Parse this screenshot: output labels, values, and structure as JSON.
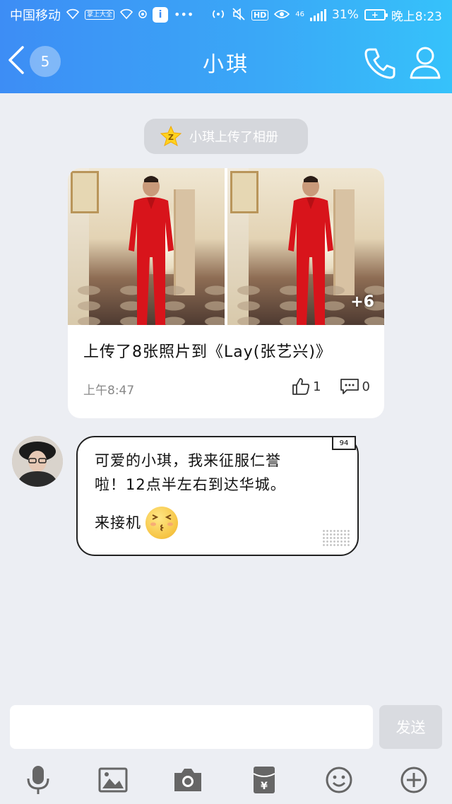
{
  "status_bar": {
    "carrier": "中国移动",
    "badge_text": "掌上大全",
    "network": "46",
    "battery_percent": "31%",
    "battery_symbol": "+",
    "time": "晚上8:23"
  },
  "nav": {
    "unread_count": "5",
    "title": "小琪"
  },
  "notice": {
    "text": "小琪上传了相册"
  },
  "album": {
    "more_photos": "+6",
    "caption": "上传了8张照片到《Lay(张艺兴)》",
    "time": "上午8:47",
    "likes": "1",
    "comments": "0"
  },
  "message": {
    "bubble_tag": "94",
    "line1": "可爱的小琪，我来征服仁誉",
    "line2": "啦！12点半左右到达华城。",
    "line3": "来接机"
  },
  "composer": {
    "input_value": "",
    "send_label": "发送"
  },
  "colors": {
    "header_start": "#3d8df5",
    "header_end": "#36c2fa",
    "chat_background": "#eceef3"
  }
}
